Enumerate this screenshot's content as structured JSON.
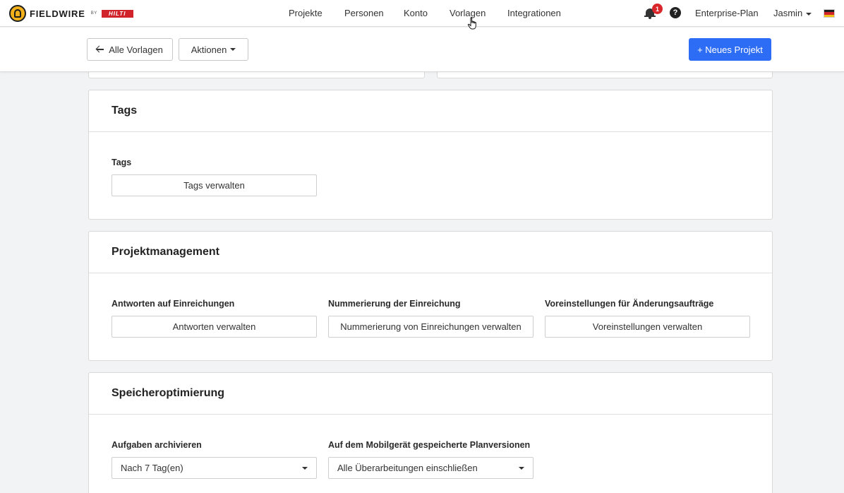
{
  "brand": {
    "name": "FIELDWIRE",
    "by": "BY",
    "partner": "HILTI"
  },
  "nav": {
    "links": [
      "Projekte",
      "Personen",
      "Konto",
      "Vorlagen",
      "Integrationen"
    ],
    "notification_count": "1",
    "help_symbol": "?",
    "plan": "Enterprise-Plan",
    "user": "Jasmin",
    "flag_colors": [
      "#1d1d1d",
      "#d1242a",
      "#f2c01b"
    ]
  },
  "toolbar": {
    "back_label": "Alle Vorlagen",
    "actions_label": "Aktionen",
    "new_project_label": "+ Neues Projekt"
  },
  "sections": {
    "tags": {
      "title": "Tags",
      "field_label": "Tags",
      "button": "Tags verwalten"
    },
    "projektmanagement": {
      "title": "Projektmanagement",
      "fields": [
        {
          "label": "Antworten auf Einreichungen",
          "button": "Antworten verwalten"
        },
        {
          "label": "Nummerierung der Einreichung",
          "button": "Nummerierung von Einreichungen verwalten"
        },
        {
          "label": "Voreinstellungen für Änderungsaufträge",
          "button": "Voreinstellungen verwalten"
        }
      ]
    },
    "speicher": {
      "title": "Speicheroptimierung",
      "fields": [
        {
          "label": "Aufgaben archivieren",
          "value": "Nach 7 Tag(en)"
        },
        {
          "label": "Auf dem Mobilgerät gespeicherte Planversionen",
          "value": "Alle Überarbeitungen einschließen"
        }
      ]
    }
  },
  "colors": {
    "primary": "#2d6cf5",
    "badge": "#d9262a",
    "logo": "#f2b11b"
  }
}
